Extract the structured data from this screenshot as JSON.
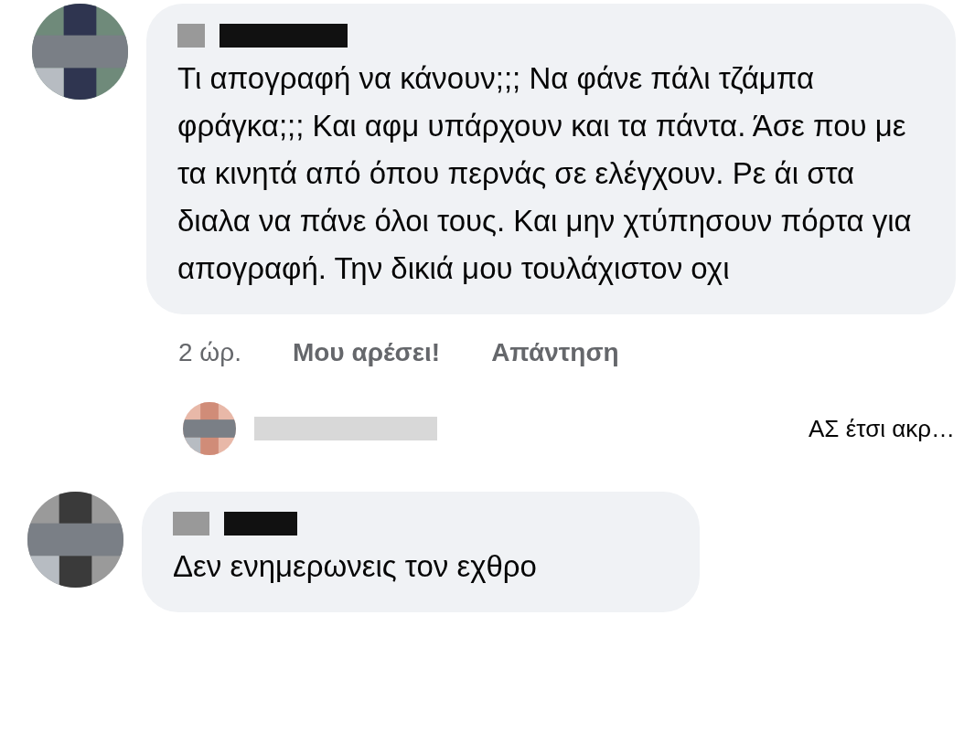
{
  "comments": [
    {
      "text": "Τι απογραφή να κάνουν;;; Να φάνε πάλι τζάμπα φράγκα;;; Και αφμ υπάρχουν και τα πάντα. Άσε που με τα κινητά από όπου περνάς σε ελέγχουν. Ρε άι στα διαλα να πάνε όλοι τους. Και μην χτύπησουν πόρτα για απογραφή. Την δικιά μου τουλάχιστον οχι",
      "time": "2 ώρ.",
      "like": "Μου αρέσει!",
      "reply": "Απάντηση",
      "reply_preview": {
        "text": "ΑΣ έτσι ακρ…"
      }
    },
    {
      "text": "Δεν ενημερωνεις τον εχθρο"
    }
  ]
}
